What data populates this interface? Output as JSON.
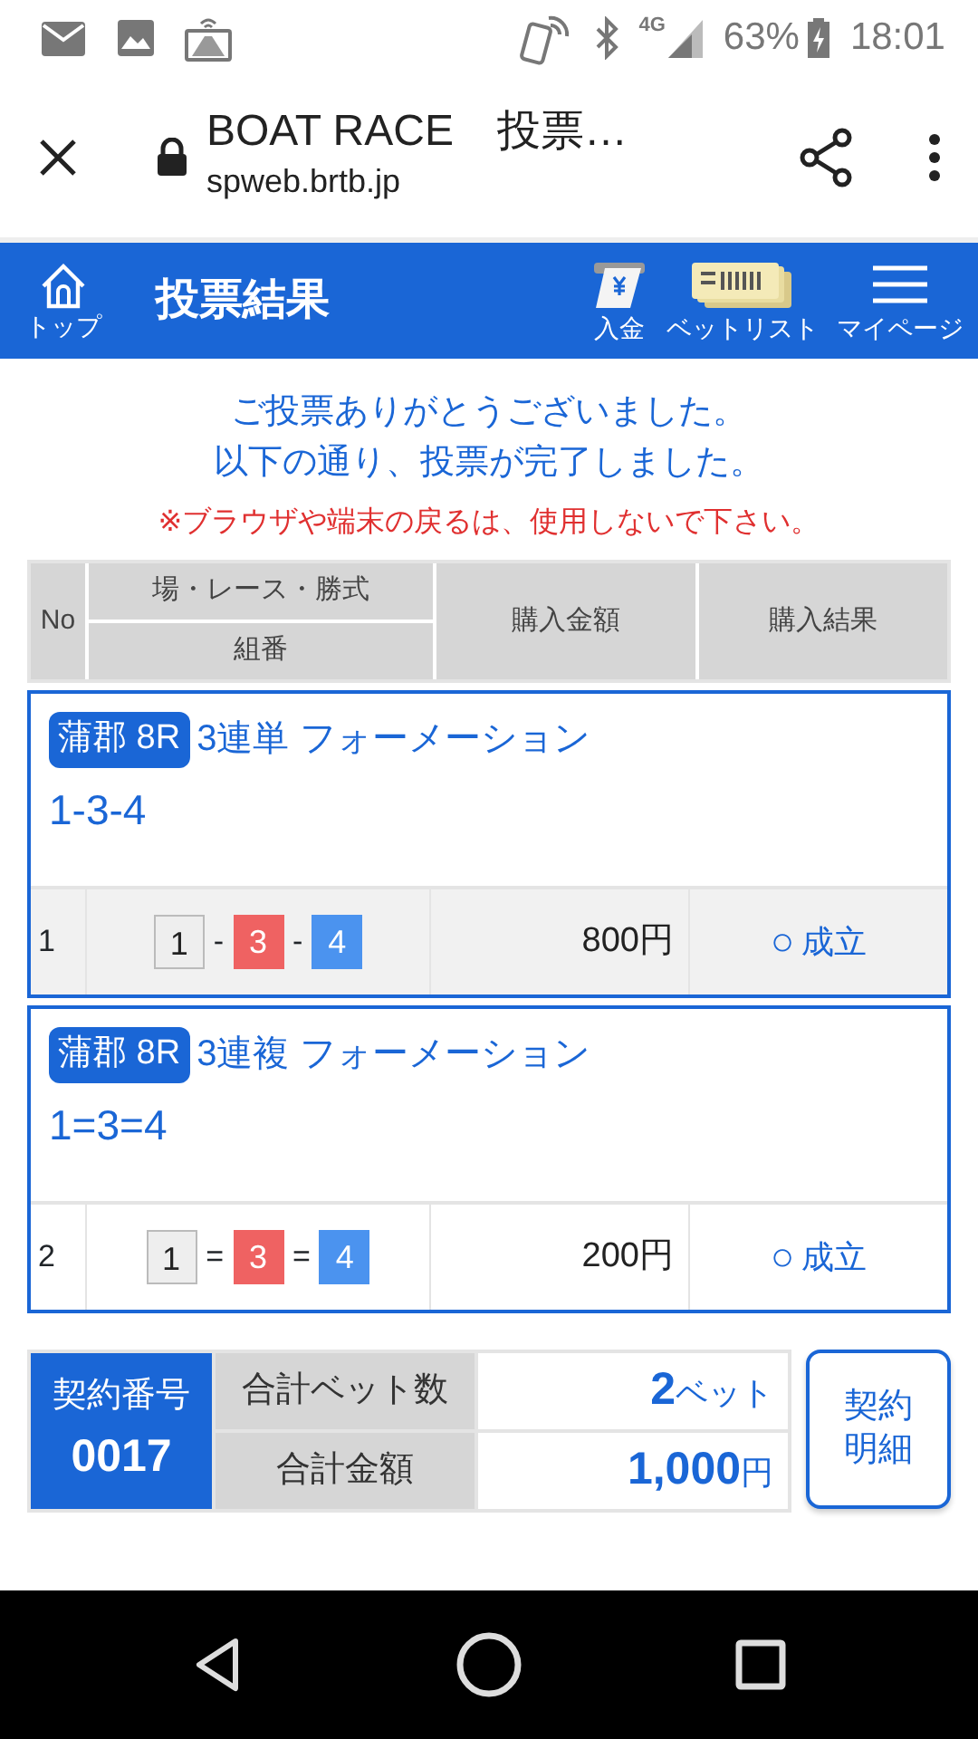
{
  "status_bar": {
    "network": "4G",
    "battery": "63%",
    "time": "18:01"
  },
  "browser": {
    "title": "BOAT RACE　投票…",
    "url": "spweb.brtb.jp"
  },
  "header": {
    "home_label": "トップ",
    "title": "投票結果",
    "actions": [
      {
        "label": "入金",
        "kind": "deposit"
      },
      {
        "label": "ベットリスト",
        "kind": "betlist"
      },
      {
        "label": "マイページ",
        "kind": "menu"
      }
    ]
  },
  "messages": [
    "ご投票ありがとうございました。",
    "以下の通り、投票が完了しました。"
  ],
  "warning": "※ブラウザや端末の戻るは、使用しないで下さい。",
  "table": {
    "columns": {
      "no": "No",
      "race": "場・レース・勝式",
      "combo": "組番",
      "amount": "購入金額",
      "result": "購入結果"
    },
    "bets": [
      {
        "venue": "蒲郡 8R",
        "type": "3連単 フォーメーション",
        "combination": "1-3-4",
        "no": "1",
        "numbers": [
          {
            "text": "1",
            "color": "#eeeeee"
          },
          {
            "text": "3",
            "color": "#ef6262"
          },
          {
            "text": "4",
            "color": "#4b93ef"
          }
        ],
        "separator": "-",
        "amount": "800円",
        "result_mark": "○",
        "result": "成立"
      },
      {
        "venue": "蒲郡 8R",
        "type": "3連複 フォーメーション",
        "combination": "1=3=4",
        "no": "2",
        "numbers": [
          {
            "text": "1",
            "color": "#eeeeee"
          },
          {
            "text": "3",
            "color": "#ef6262"
          },
          {
            "text": "4",
            "color": "#4b93ef"
          }
        ],
        "separator": "=",
        "amount": "200円",
        "result_mark": "○",
        "result": "成立"
      }
    ]
  },
  "summary": {
    "contract_label": "契約番号",
    "contract_no": "0017",
    "rows": [
      {
        "label": "合計ベット数",
        "value": "2",
        "unit": "ベット"
      },
      {
        "label": "合計金額",
        "value": "1,000",
        "unit": "円"
      }
    ],
    "button": "契約明細"
  }
}
